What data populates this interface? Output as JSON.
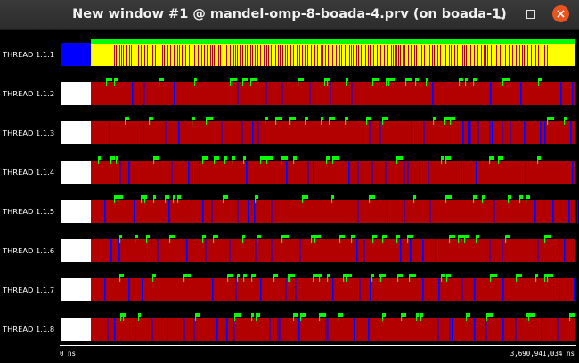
{
  "window": {
    "title": "New window #1 @ mandel-omp-8-boada-4.prv (on boada-1)",
    "buttons": {
      "minimize": "minimize-icon",
      "maximize": "maximize-icon",
      "close": "close-icon"
    }
  },
  "colors": {
    "running": "#b30000",
    "idle_sync": "#ffff00",
    "user_function": "#0000ff",
    "burst": "#00ff00",
    "background": "#000000",
    "not_created": "#ffffff"
  },
  "threads": [
    {
      "label": "THREAD 1.1.1",
      "type": "master"
    },
    {
      "label": "THREAD 1.1.2",
      "type": "worker"
    },
    {
      "label": "THREAD 1.1.3",
      "type": "worker"
    },
    {
      "label": "THREAD 1.1.4",
      "type": "worker"
    },
    {
      "label": "THREAD 1.1.5",
      "type": "worker"
    },
    {
      "label": "THREAD 1.1.6",
      "type": "worker"
    },
    {
      "label": "THREAD 1.1.7",
      "type": "worker"
    },
    {
      "label": "THREAD 1.1.8",
      "type": "worker"
    }
  ],
  "axis": {
    "start_label": "0 ns",
    "end_label": "3,690,941,034 ns"
  }
}
